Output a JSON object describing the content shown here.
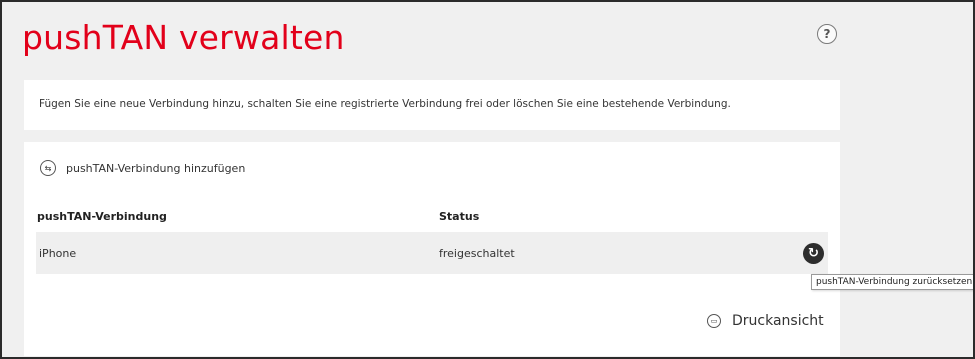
{
  "page": {
    "title": "pushTAN verwalten",
    "help_icon": "?",
    "intro": "Fügen Sie eine neue Verbindung hinzu, schalten Sie eine registrierte Verbindung frei oder löschen Sie eine bestehende Verbindung."
  },
  "actions": {
    "add_label": "pushTAN-Verbindung hinzufügen",
    "add_icon_name": "add-connection-icon",
    "print_label": "Druckansicht",
    "print_icon_name": "printer-icon"
  },
  "table": {
    "headers": [
      "pushTAN-Verbindung",
      "Status"
    ],
    "rows": [
      {
        "device": "iPhone",
        "status": "freigeschaltet",
        "action_icon": "reset-icon"
      }
    ]
  },
  "tooltip": {
    "text": "pushTAN-Verbindung zurücksetzen"
  },
  "colors": {
    "brand_red": "#e2001a",
    "background": "#f0f0f0",
    "panel": "#ffffff",
    "row_highlight": "#efefef",
    "icon_dark": "#2d2d2d"
  }
}
